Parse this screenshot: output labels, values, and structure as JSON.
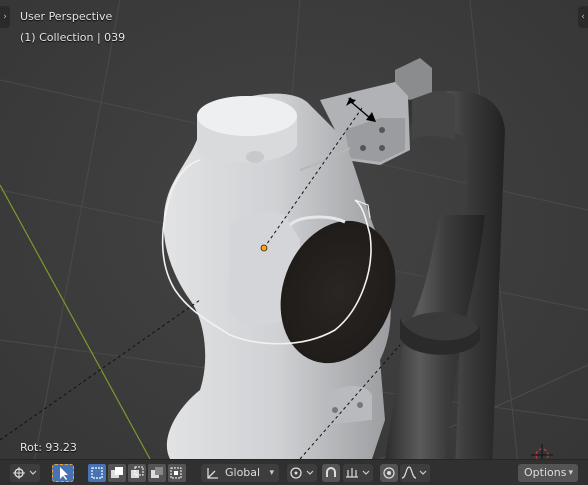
{
  "viewport": {
    "view_name": "User Perspective",
    "collection_info": "(1) Collection | 039",
    "operator_readout": "Rot: 93.23"
  },
  "toolbar": {
    "transform_orientation": "Global",
    "options_label": "Options",
    "selection_modes": [
      "set-selection",
      "extend-selection",
      "subtract-selection",
      "difference-selection",
      "intersect-selection"
    ],
    "icons": [
      "object-mode-icon",
      "select-cursor-icon",
      "orientation-icon",
      "pivot-icon",
      "snap-icon",
      "snap-target-icon",
      "proportional-edit-icon",
      "falloff-curve-icon"
    ]
  },
  "colors": {
    "background": "#3c3c3c",
    "toolbar": "#303030",
    "button": "#545454",
    "active": "#4772b3",
    "selection_outline": "#f0f0f0",
    "origin": "#ff9f1a",
    "x_axis": "#9c3a3a",
    "y_axis": "#7a9a2f"
  }
}
